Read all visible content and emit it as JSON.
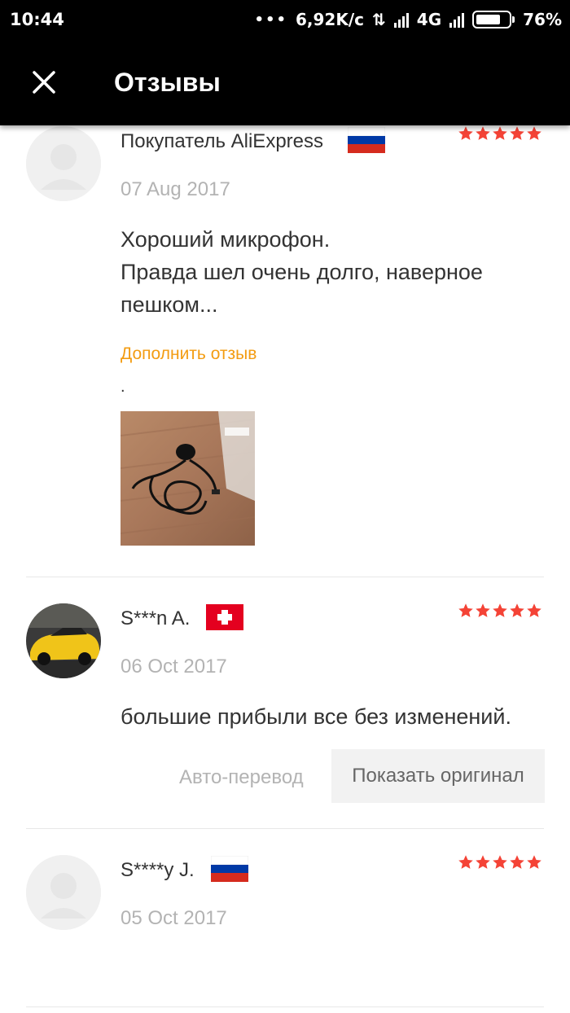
{
  "status_bar": {
    "time": "10:44",
    "speed": "6,92K/c",
    "network": "4G",
    "battery": "76%"
  },
  "app_bar": {
    "title": "Отзывы",
    "close_icon": "close-icon"
  },
  "colors": {
    "star": "#f44336",
    "link": "#f39c12",
    "date": "#b3b3b3"
  },
  "reviews": [
    {
      "name": "Покупатель AliExpress",
      "flag": "russia-flag",
      "rating": 5,
      "date": "07 Aug 2017",
      "text": "Хороший микрофон.\nПравда шел очень долго, наверное пешком...",
      "append_link": "Дополнить отзыв",
      "follow_up": "."
    },
    {
      "name": "S***n A.",
      "flag": "switzerland-flag",
      "rating": 5,
      "date": "06 Oct 2017",
      "text": "большие прибыли все без изменений.",
      "auto_translate": "Авто-перевод",
      "show_original": "Показать оригинал"
    },
    {
      "name": "S****y J.",
      "flag": "russia-flag",
      "rating": 5,
      "date": "05 Oct 2017"
    }
  ]
}
